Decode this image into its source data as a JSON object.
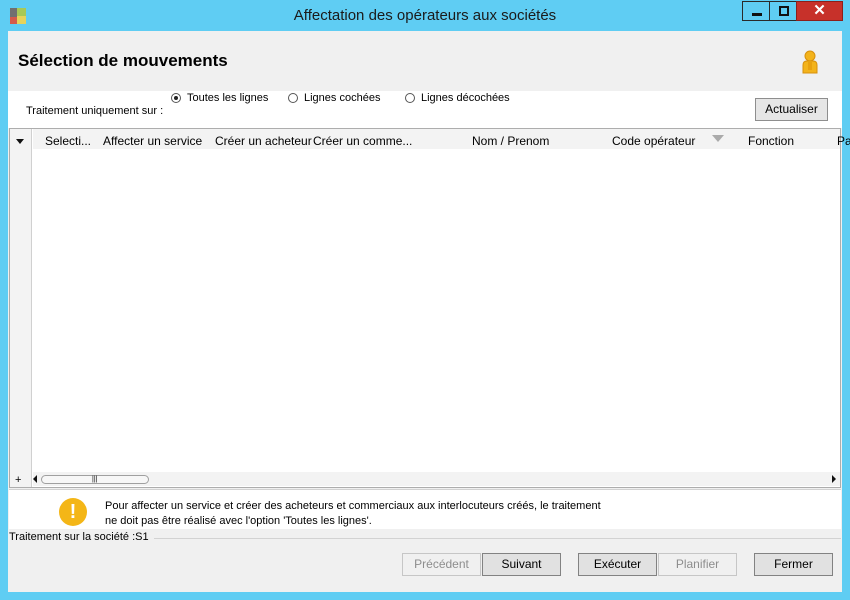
{
  "window": {
    "title": "Affectation des opérateurs aux sociétés",
    "controls": {
      "minimize": "minimize",
      "maximize": "maximize",
      "close": "✕"
    }
  },
  "header": {
    "title": "Sélection de mouvements",
    "user_icon": "user-icon"
  },
  "treatment": {
    "label": "Traitement uniquement sur :",
    "options": [
      {
        "label": "Toutes les lignes",
        "selected": true
      },
      {
        "label": "Lignes cochées",
        "selected": false
      },
      {
        "label": "Lignes décochées",
        "selected": false
      }
    ],
    "refresh_label": "Actualiser"
  },
  "grid": {
    "columns": [
      "Selecti...",
      "Affecter un service",
      "Créer un acheteur",
      "Créer un comme...",
      "Nom / Prenom",
      "Code opérateur",
      "Fonction",
      "Pa"
    ],
    "rows": [],
    "add_row": "+",
    "thumb_grip": "|||"
  },
  "note": {
    "icon": "warning-icon",
    "line1": "Pour affecter un service et créer des acheteurs et commerciaux aux interlocuteurs créés, le traitement",
    "line2": "ne doit pas être réalisé avec l'option 'Toutes les lignes'."
  },
  "status": {
    "text": "Traitement sur la société :S1"
  },
  "footer": {
    "previous": "Précédent",
    "next": "Suivant",
    "execute": "Exécuter",
    "plan": "Planifier",
    "close": "Fermer"
  },
  "colors": {
    "titlebar": "#5fcdf3",
    "close_button": "#c7312a",
    "warning": "#f4b617"
  }
}
